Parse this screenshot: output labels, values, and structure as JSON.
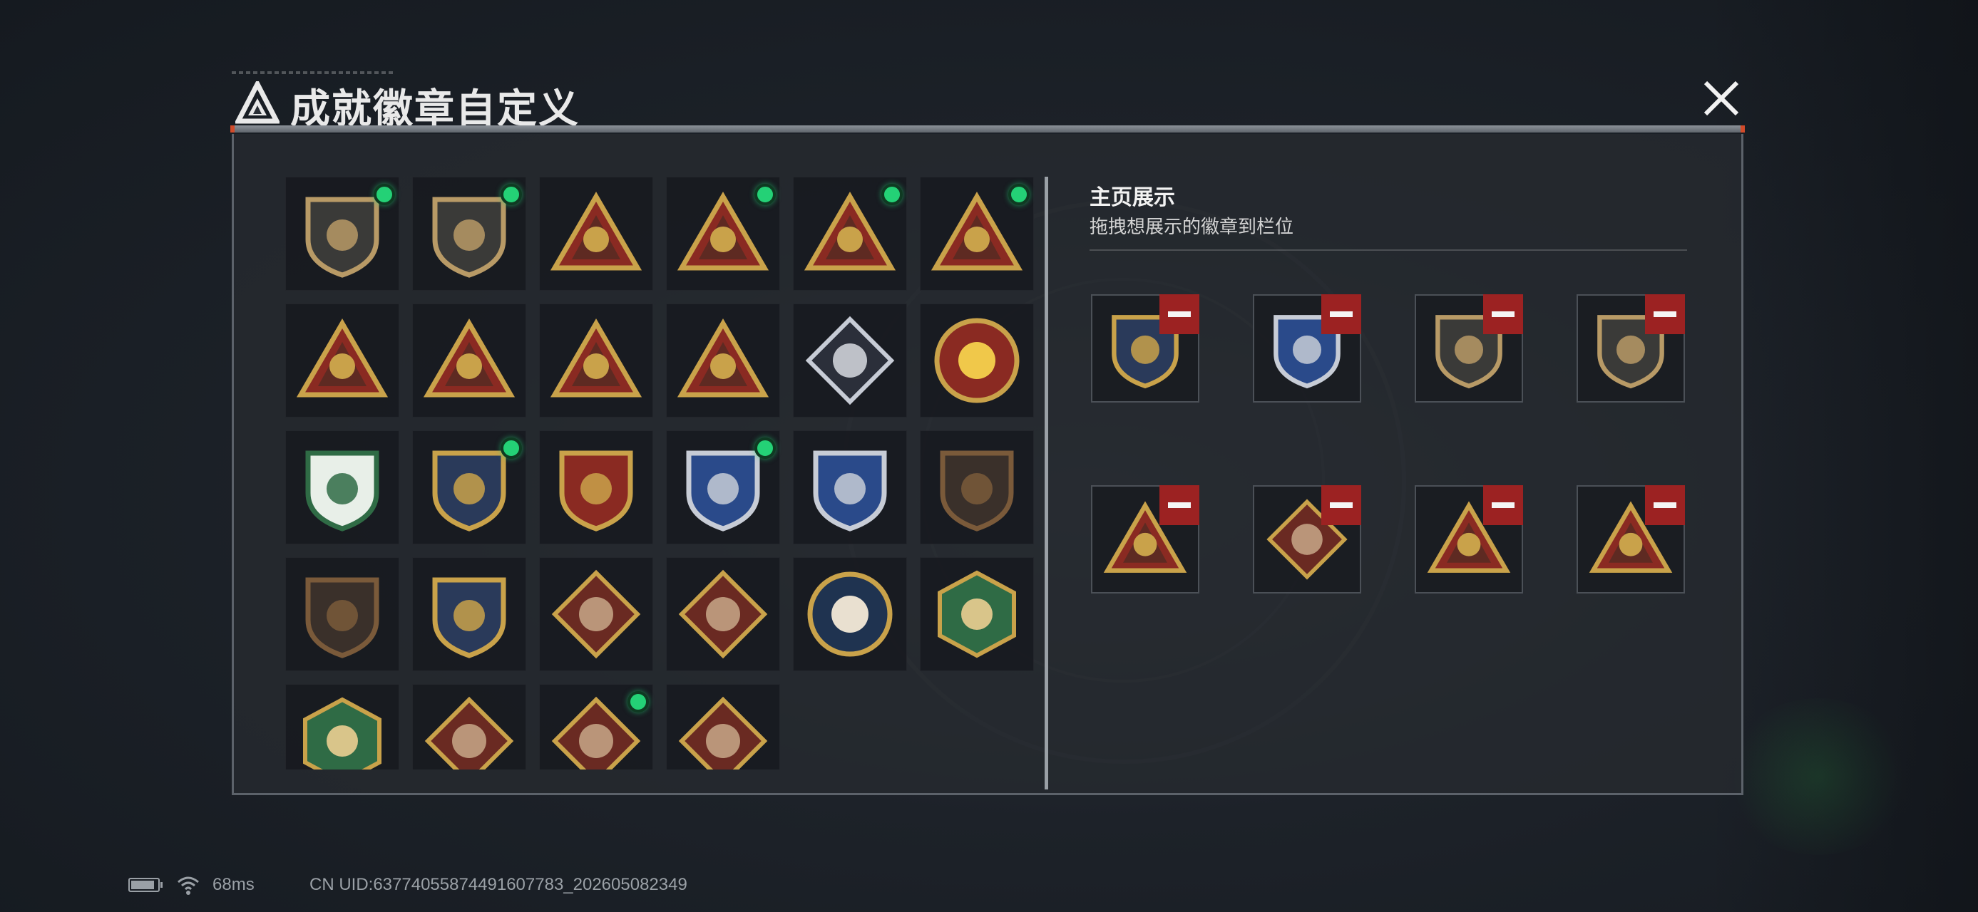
{
  "window": {
    "title": "成就徽章自定义",
    "logo_icon": "delta-triangle-logo",
    "close_icon": "close-x-icon"
  },
  "badge_grid": {
    "items": [
      {
        "icon": "delta-logo-shield-badge",
        "new": true
      },
      {
        "icon": "helicopter-shield-badge",
        "new": true
      },
      {
        "icon": "satellite-dish-triangle-badge",
        "new": false
      },
      {
        "icon": "s4-emblem-triangle-badge",
        "new": true
      },
      {
        "icon": "s5-emblem-triangle-badge",
        "new": true
      },
      {
        "icon": "s6-emblem-triangle-badge",
        "new": true
      },
      {
        "icon": "s8-emblem-triangle-badge",
        "new": false
      },
      {
        "icon": "boat-triangle-badge",
        "new": false
      },
      {
        "icon": "number-one-triangle-badge",
        "new": false
      },
      {
        "icon": "squad-triangle-badge",
        "new": false
      },
      {
        "icon": "rose-diamond-badge",
        "new": false
      },
      {
        "icon": "star-roundel-badge",
        "new": false
      },
      {
        "icon": "green-medic-shield-badge",
        "new": false
      },
      {
        "icon": "gold-stars-shield-badge",
        "new": true
      },
      {
        "icon": "red-gem-shield-badge",
        "new": false
      },
      {
        "icon": "blue-crosshair-rifle-badge",
        "new": true
      },
      {
        "icon": "blue-crosshair-rifle-badge-2",
        "new": false
      },
      {
        "icon": "bronze-rifle-shield-badge",
        "new": false
      },
      {
        "icon": "bronze-sniper-shield-badge",
        "new": false
      },
      {
        "icon": "gold-crosshair-shield-badge",
        "new": false
      },
      {
        "icon": "wolf-diamond-badge",
        "new": false
      },
      {
        "icon": "wolf-diamond-badge-2",
        "new": false
      },
      {
        "icon": "eagle-round-badge",
        "new": false
      },
      {
        "icon": "wasp-hexagon-badge",
        "new": false
      },
      {
        "icon": "green-weapon-hexagon-badge",
        "new": false
      },
      {
        "icon": "dragon-diamond-badge",
        "new": false
      },
      {
        "icon": "dragon-diamond-badge-2",
        "new": true
      },
      {
        "icon": "runner-diamond-badge",
        "new": false
      }
    ]
  },
  "homepage_display": {
    "title": "主页展示",
    "subtitle": "拖拽想展示的徽章到栏位",
    "slots": [
      {
        "icon": "gold-stars-shield-badge"
      },
      {
        "icon": "blue-crosshair-rifle-badge"
      },
      {
        "icon": "delta-logo-shield-badge"
      },
      {
        "icon": "helicopter-shield-badge"
      },
      {
        "icon": "s6-emblem-triangle-badge"
      },
      {
        "icon": "dragon-diamond-badge"
      },
      {
        "icon": "s4-emblem-triangle-badge"
      },
      {
        "icon": "s5-emblem-triangle-badge"
      }
    ],
    "remove_icon": "minus-icon"
  },
  "status_bar": {
    "battery_icon": "battery-icon",
    "wifi_icon": "wifi-icon",
    "ping": "68ms",
    "uid": "CN UID:63774055874491607783_202605082349"
  },
  "colors": {
    "new_dot": "#24d176",
    "remove_button": "#9c2222",
    "gold": "#c9a24a",
    "panel_border": "#5c626a"
  }
}
